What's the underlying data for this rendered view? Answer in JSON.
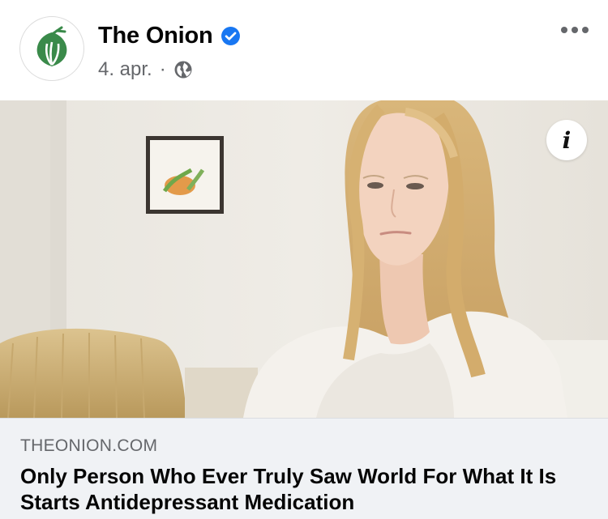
{
  "post": {
    "page_name": "The Onion",
    "date": "4. apr.",
    "separator": "·",
    "icons": {
      "avatar": "onion-logo-icon",
      "verified": "verified-badge-icon",
      "audience": "globe-icon",
      "more": "more-options-icon",
      "info": "info-icon"
    },
    "colors": {
      "verified_blue": "#1877f2",
      "logo_green": "#3a8a4a",
      "footer_bg": "#f0f2f5"
    }
  },
  "link_preview": {
    "info_label": "i",
    "domain": "THEONION.COM",
    "title": "Only Person Who Ever Truly Saw World For What It Is Starts Antidepressant Medication"
  }
}
